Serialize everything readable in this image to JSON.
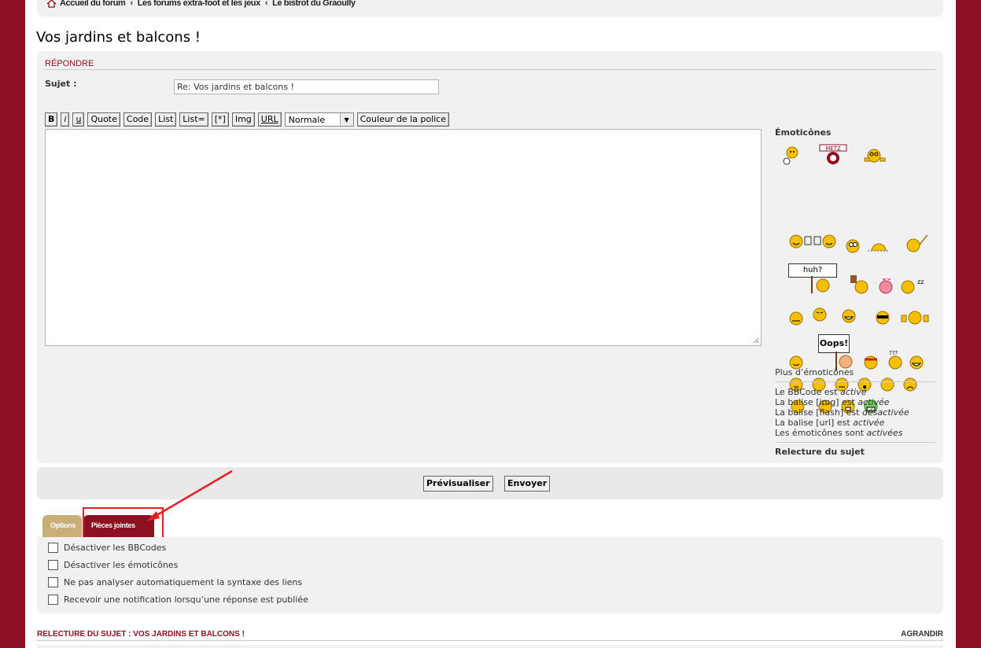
{
  "breadcrumb": {
    "items": [
      "Accueil du forum",
      "Les forums extra-foot et les jeux",
      "Le bistrot du Graoully"
    ],
    "separator": "‹"
  },
  "page_title": "Vos jardins et balcons !",
  "post_form": {
    "heading": "Répondre",
    "subject_label": "Sujet :",
    "subject_value": "Re: Vos jardins et balcons !",
    "toolbar": {
      "bold": "B",
      "italic": "i",
      "underline": "u",
      "quote": "Quote",
      "code": "Code",
      "list": "List",
      "list_eq": "List=",
      "list_item": "[*]",
      "img": "Img",
      "url": "URL",
      "font_size_value": "Normale",
      "font_color": "Couleur de la police"
    },
    "message_value": ""
  },
  "smilies": {
    "title": "Émoticônes",
    "more": "Plus d’émoticônes",
    "sign_huh": "huh?",
    "sign_oops": "Oops!",
    "sign_metz": "METZ"
  },
  "status": {
    "bbcode_prefix": "Le BBCode est ",
    "bbcode_state": "activé",
    "img_prefix": "La balise [img] est ",
    "img_state": "activée",
    "flash_prefix": "La balise [flash] est ",
    "flash_state": "désactivée",
    "url_prefix": "La balise [url] est ",
    "url_state": "activée",
    "smilies_prefix": "Les émoticônes sont ",
    "smilies_state": "activées"
  },
  "review_link": "Relecture du sujet",
  "buttons": {
    "preview": "Prévisualiser",
    "submit": "Envoyer"
  },
  "tabs": {
    "options": "Options",
    "attachments": "Pièces jointes"
  },
  "options": [
    "Désactiver les BBCodes",
    "Désactiver les émoticônes",
    "Ne pas analyser automatiquement la syntaxe des liens",
    "Recevoir une notification lorsqu’une réponse est publiée"
  ],
  "topic_review": {
    "heading": "RELECTURE DU SUJET : VOS JARDINS ET BALCONS !",
    "expand": "AGRANDIR"
  },
  "colors": {
    "brand": "#8c1022",
    "tab_options": "#c9af77",
    "annotation": "#e81d22"
  }
}
